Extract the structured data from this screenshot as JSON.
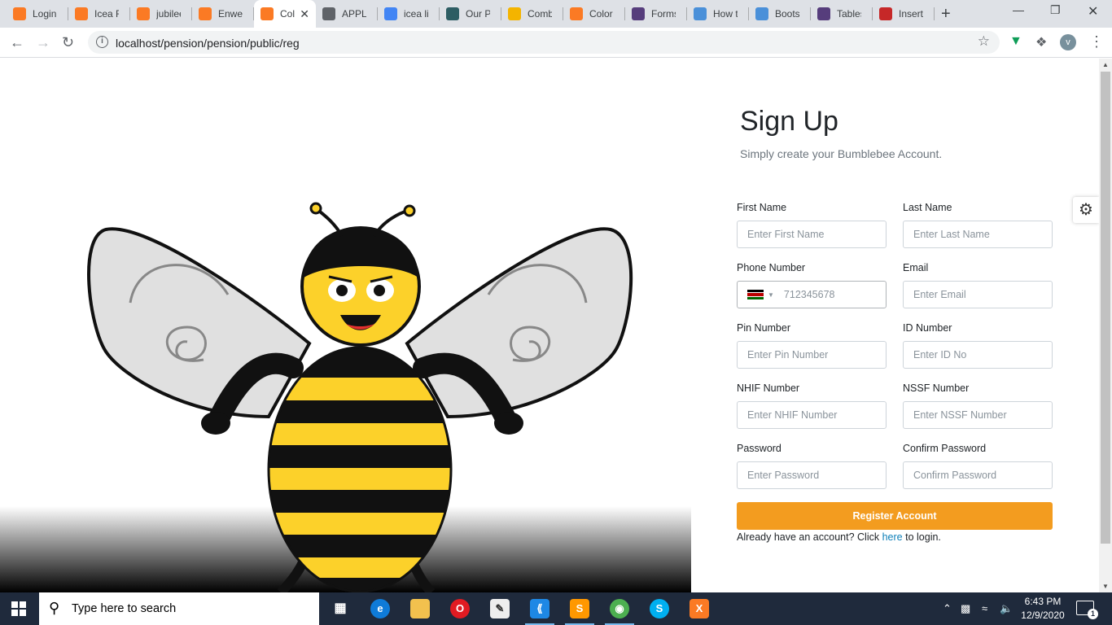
{
  "browser": {
    "tabs": [
      {
        "title": "Login",
        "icon": "xampp-icon",
        "color": "#fb7a24"
      },
      {
        "title": "Icea Fo",
        "icon": "xampp-icon",
        "color": "#fb7a24"
      },
      {
        "title": "jubilee",
        "icon": "xampp-icon",
        "color": "#fb7a24"
      },
      {
        "title": "Enweal",
        "icon": "xampp-icon",
        "color": "#fb7a24"
      },
      {
        "title": "Col",
        "icon": "xampp-icon",
        "color": "#fb7a24",
        "active": true
      },
      {
        "title": "APPLIC",
        "icon": "globe-icon",
        "color": "#5f6368"
      },
      {
        "title": "icea lic",
        "icon": "google-icon",
        "color": "#4285f4"
      },
      {
        "title": "Our Pa",
        "icon": "leaf-icon",
        "color": "#2d5d63"
      },
      {
        "title": "Combi",
        "icon": "chain-icon",
        "color": "#f4b400"
      },
      {
        "title": "Color",
        "icon": "xampp-icon",
        "color": "#fb7a24"
      },
      {
        "title": "Forms",
        "icon": "bootstrap-icon",
        "color": "#563d7c"
      },
      {
        "title": "How to",
        "icon": "checker-icon",
        "color": "#4a90d9"
      },
      {
        "title": "Bootst",
        "icon": "checker-icon",
        "color": "#4a90d9"
      },
      {
        "title": "Tables",
        "icon": "bootstrap-icon",
        "color": "#563d7c"
      },
      {
        "title": "Insert",
        "icon": "w3-icon",
        "color": "#c62828"
      }
    ],
    "url": "localhost/pension/pension/public/reg",
    "profile_initial": "v"
  },
  "signup": {
    "title": "Sign Up",
    "subtitle": "Simply create your Bumblebee Account.",
    "fields": {
      "first_name": {
        "label": "First Name",
        "placeholder": "Enter First Name"
      },
      "last_name": {
        "label": "Last Name",
        "placeholder": "Enter Last Name"
      },
      "phone": {
        "label": "Phone Number",
        "placeholder": "712345678"
      },
      "email": {
        "label": "Email",
        "placeholder": "Enter Email"
      },
      "pin": {
        "label": "Pin Number",
        "placeholder": "Enter Pin Number"
      },
      "id": {
        "label": "ID Number",
        "placeholder": "Enter ID No"
      },
      "nhif": {
        "label": "NHIF Number",
        "placeholder": "Enter NHIF Number"
      },
      "nssf": {
        "label": "NSSF Number",
        "placeholder": "Enter NSSF Number"
      },
      "password": {
        "label": "Password",
        "placeholder": "Enter Password"
      },
      "confirm": {
        "label": "Confirm Password",
        "placeholder": "Confirm Password"
      }
    },
    "register_label": "Register Account",
    "login_prefix": "Already have an account? Click",
    "login_link": "here",
    "login_suffix": "to login.",
    "accent": "#f39c1f"
  },
  "taskbar": {
    "search_placeholder": "Type here to search",
    "time": "6:43 PM",
    "date": "12/9/2020",
    "notifications": "1"
  }
}
